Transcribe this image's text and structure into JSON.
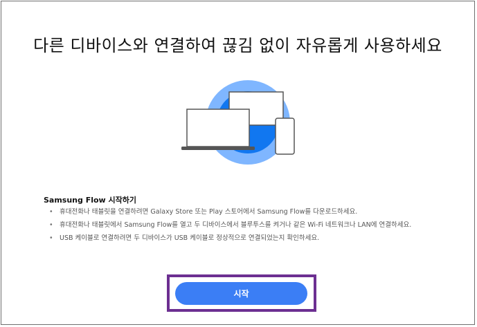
{
  "headline": "다른 디바이스와 연결하여 끊김 없이 자유롭게 사용하세요",
  "illustration": {
    "icon": "devices-illustration",
    "circle_outer": "#7fb6ff",
    "circle_inner": "#1177f0"
  },
  "info": {
    "title": "Samsung Flow 시작하기",
    "items": [
      "휴대전화나 태블릿을 연결하려면 Galaxy Store 또는 Play 스토어에서 Samsung Flow를 다운로드하세요.",
      "휴대전화나 태블릿에서 Samsung Flow를 열고 두 디바이스에서 블루투스를 켜거나 같은 Wi-Fi 네트워크나 LAN에 연결하세요.",
      "USB 케이블로 연결하려면 두 디바이스가 USB 케이블로 정상적으로 연결되었는지 확인하세요."
    ]
  },
  "start_button": {
    "label": "시작",
    "color": "#3b7ef5"
  },
  "highlight_color": "#6c2f91"
}
